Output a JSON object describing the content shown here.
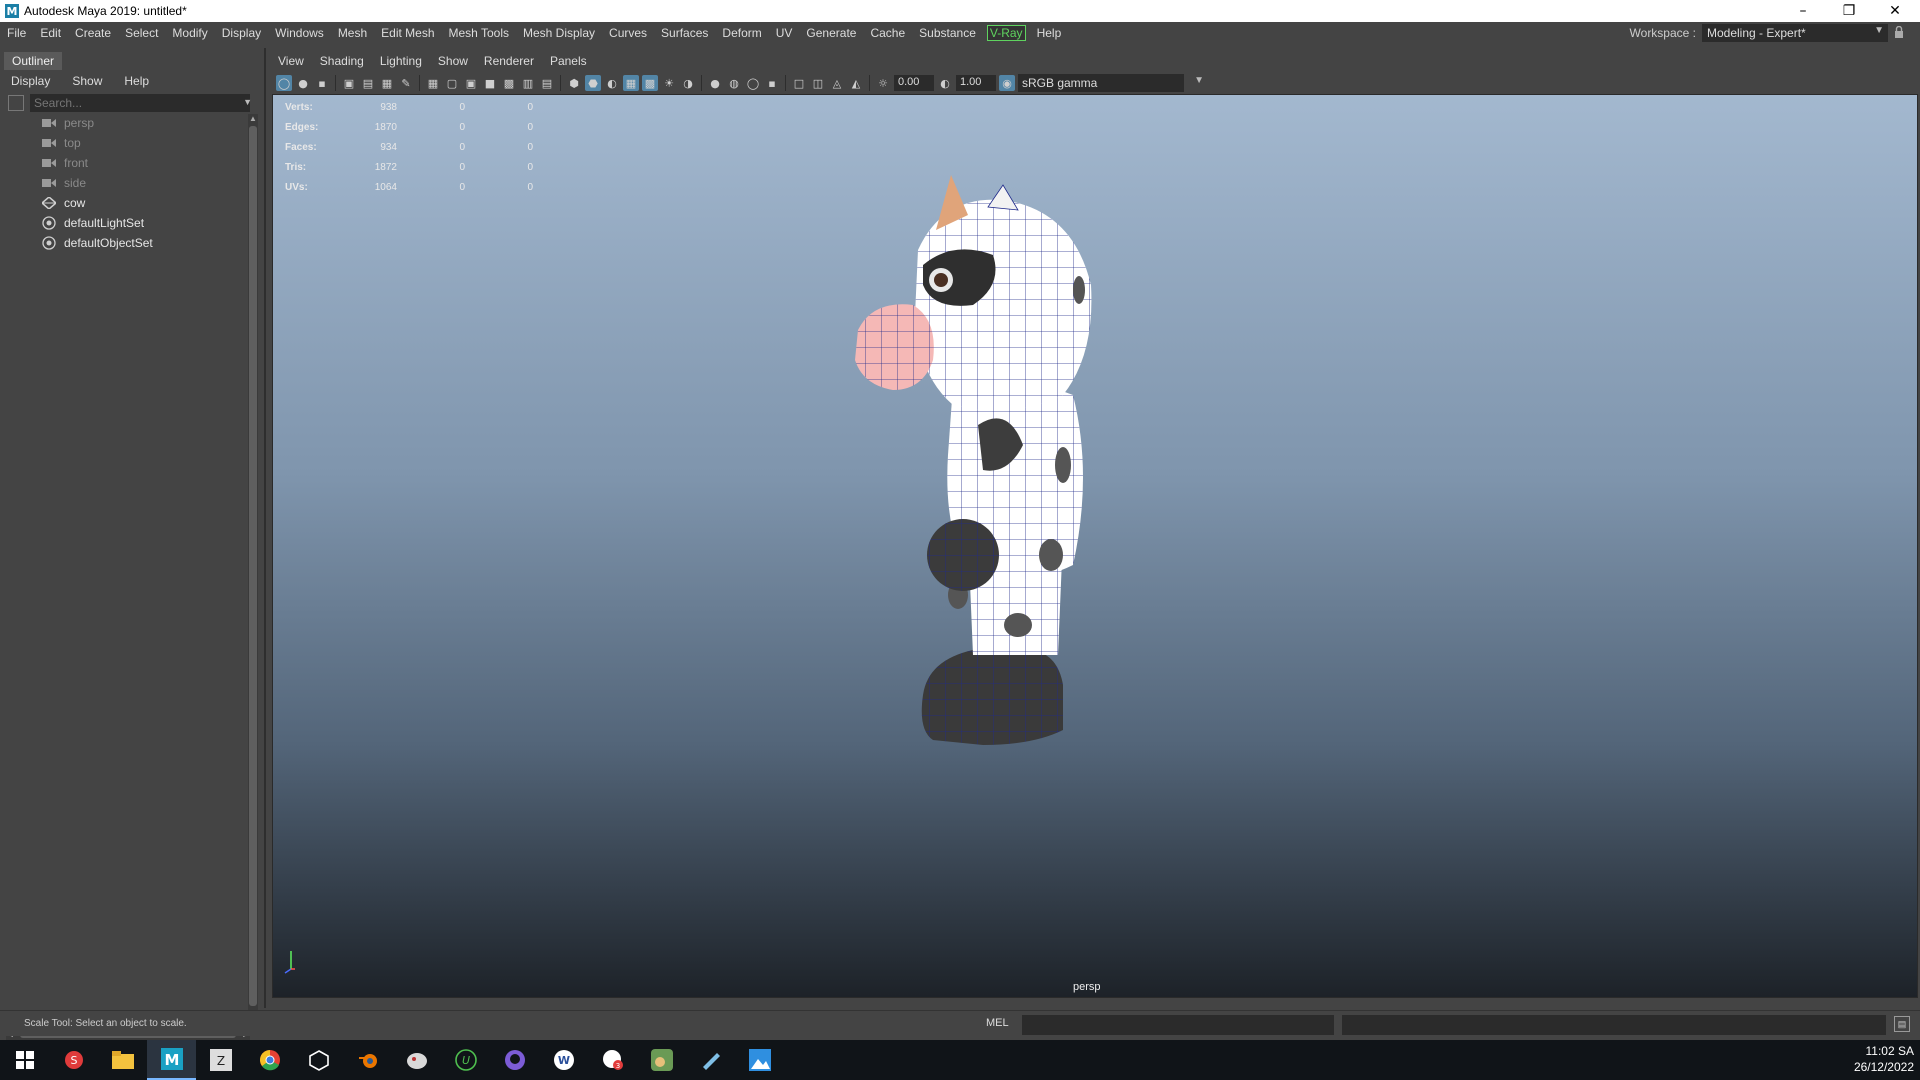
{
  "window": {
    "title": "Autodesk Maya 2019: untitled*"
  },
  "menubar": {
    "items": [
      "File",
      "Edit",
      "Create",
      "Select",
      "Modify",
      "Display",
      "Windows",
      "Mesh",
      "Edit Mesh",
      "Mesh Tools",
      "Mesh Display",
      "Curves",
      "Surfaces",
      "Deform",
      "UV",
      "Generate",
      "Cache",
      "Substance"
    ],
    "vray": "V-Ray",
    "help": "Help"
  },
  "workspace": {
    "label": "Workspace :",
    "value": "Modeling - Expert*"
  },
  "outliner": {
    "tab": "Outliner",
    "menu": [
      "Display",
      "Show",
      "Help"
    ],
    "search_placeholder": "Search...",
    "nodes": [
      {
        "label": "persp",
        "icon": "camera-icon"
      },
      {
        "label": "top",
        "icon": "camera-icon"
      },
      {
        "label": "front",
        "icon": "camera-icon"
      },
      {
        "label": "side",
        "icon": "camera-icon"
      },
      {
        "label": "cow",
        "icon": "mesh-icon"
      },
      {
        "label": "defaultLightSet",
        "icon": "set-icon"
      },
      {
        "label": "defaultObjectSet",
        "icon": "set-icon"
      }
    ]
  },
  "viewport": {
    "menu": [
      "View",
      "Shading",
      "Lighting",
      "Show",
      "Renderer",
      "Panels"
    ],
    "exposure": "0.00",
    "gamma": "1.00",
    "color_space": "sRGB gamma",
    "camera": "persp",
    "hud": [
      {
        "key": "Verts:",
        "v1": "938",
        "v2": "0",
        "v3": "0"
      },
      {
        "key": "Edges:",
        "v1": "1870",
        "v2": "0",
        "v3": "0"
      },
      {
        "key": "Faces:",
        "v1": "934",
        "v2": "0",
        "v3": "0"
      },
      {
        "key": "Tris:",
        "v1": "1872",
        "v2": "0",
        "v3": "0"
      },
      {
        "key": "UVs:",
        "v1": "1064",
        "v2": "0",
        "v3": "0"
      }
    ]
  },
  "commandline": {
    "help": "Scale Tool: Select an object to scale.",
    "mel": "MEL"
  },
  "taskbar": {
    "time": "11:02 SA",
    "date": "26/12/2022"
  }
}
